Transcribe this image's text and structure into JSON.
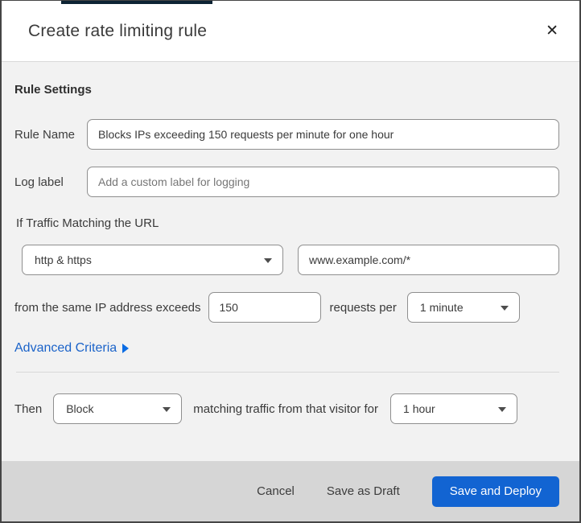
{
  "colors": {
    "accent_blue": "#1264d2",
    "link_blue": "#1b63c9",
    "body_bg": "#f2f2f2",
    "footer_bg": "#d6d6d6",
    "top_strip_navy": "#0d2334"
  },
  "header": {
    "title": "Create rate limiting rule",
    "close_icon": "✕"
  },
  "body": {
    "section_heading": "Rule Settings",
    "rule_name": {
      "label": "Rule Name",
      "value": "Blocks IPs exceeding 150 requests per minute for one hour"
    },
    "log_label": {
      "label": "Log label",
      "placeholder": "Add a custom label for logging"
    },
    "traffic": {
      "intro": "If Traffic Matching the URL",
      "scheme_selected": "http & https",
      "url_value": "www.example.com/*"
    },
    "threshold": {
      "text_before": "from the same IP address exceeds",
      "requests_value": "150",
      "text_between": "requests per",
      "period_selected": "1 minute"
    },
    "advanced_criteria_label": "Advanced Criteria",
    "then": {
      "text_before": "Then",
      "action_selected": "Block",
      "text_between": "matching traffic from that visitor for",
      "duration_selected": "1 hour"
    }
  },
  "footer": {
    "cancel_label": "Cancel",
    "save_draft_label": "Save as Draft",
    "save_deploy_label": "Save and Deploy"
  }
}
